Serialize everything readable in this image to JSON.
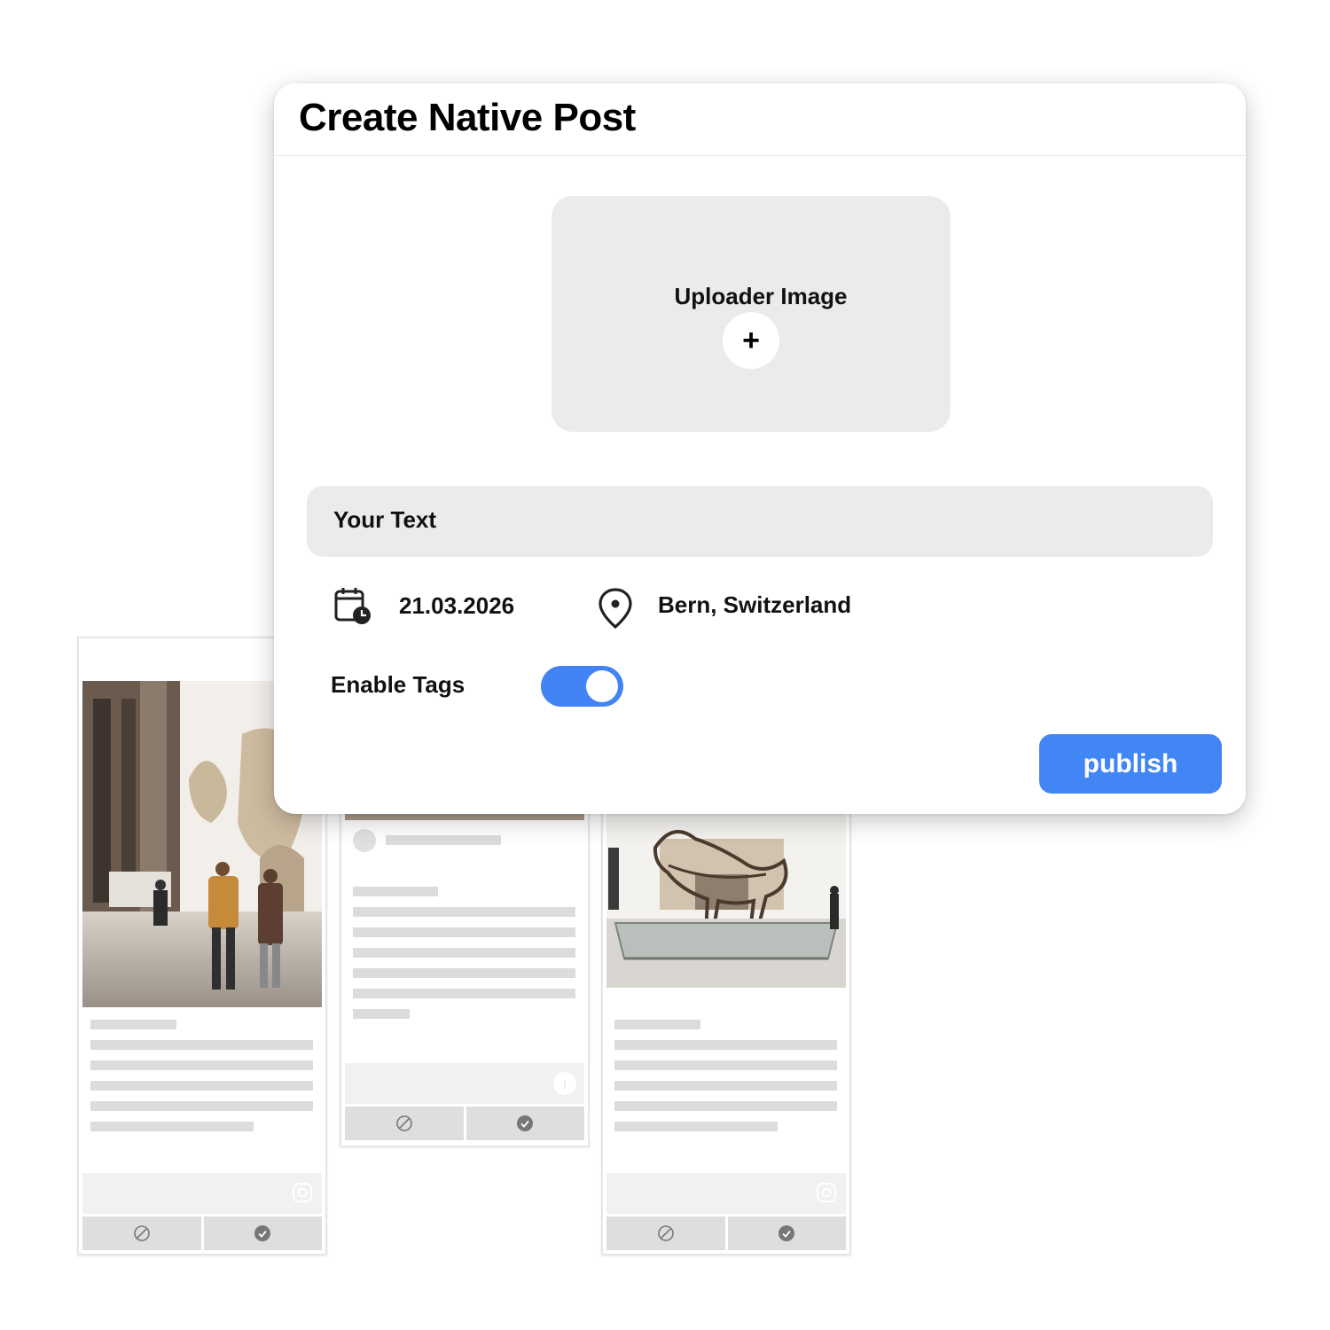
{
  "modal": {
    "title": "Create Native Post",
    "uploader_label": "Uploader Image",
    "add_symbol": "+",
    "text_placeholder": "Your Text",
    "date": "21.03.2026",
    "location": "Bern, Switzerland",
    "tags_label": "Enable Tags",
    "tags_enabled": true,
    "publish_label": "publish",
    "accent_color": "#4285f4"
  },
  "background_cards": [
    {
      "image": "museum-hall-with-visitors-photo",
      "footer_icon": "instagram-icon",
      "actions": [
        "block-icon",
        "approve-check-icon"
      ]
    },
    {
      "image": "hidden-behind-modal",
      "footer_icon": "info-icon",
      "actions": [
        "block-icon",
        "approve-check-icon"
      ]
    },
    {
      "image": "dinosaur-skeleton-exhibit-photo",
      "footer_icon": "instagram-icon",
      "actions": [
        "block-icon",
        "approve-check-icon"
      ]
    }
  ]
}
